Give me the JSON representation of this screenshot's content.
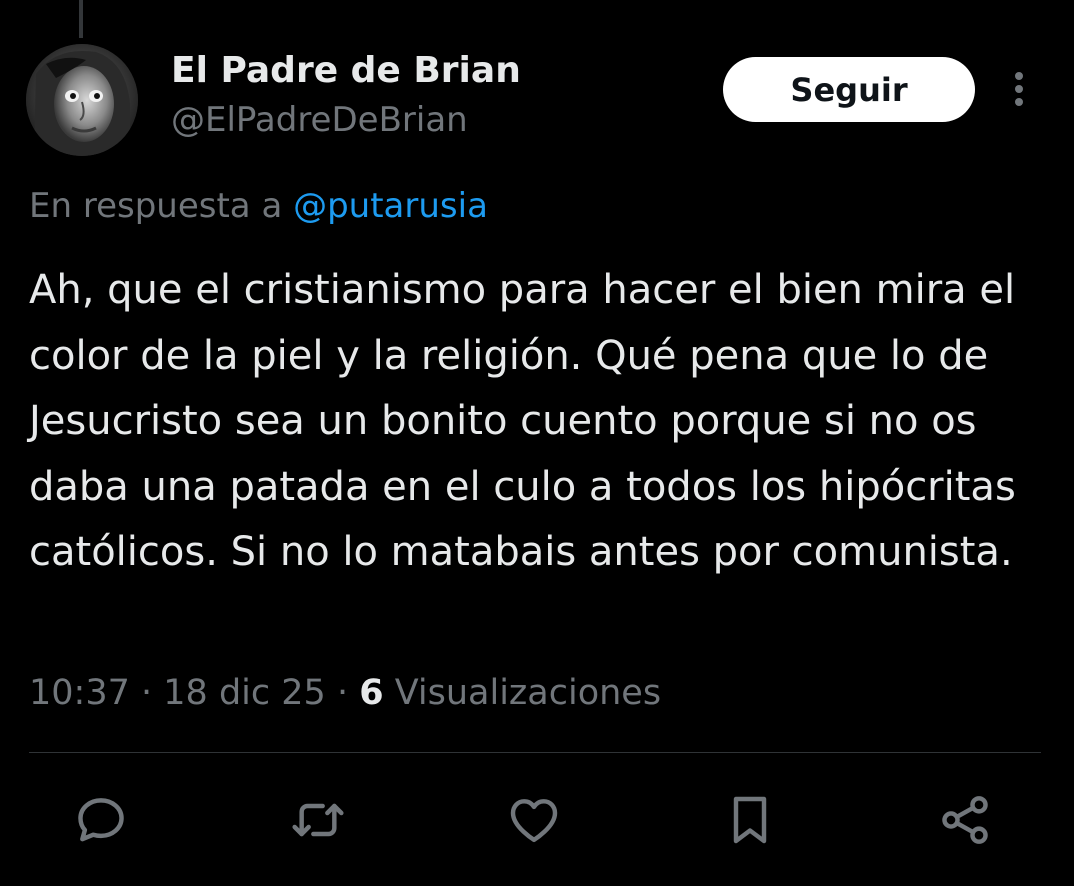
{
  "tweet": {
    "author": {
      "display_name": "El Padre de Brian",
      "handle": "@ElPadreDeBrian"
    },
    "follow_label": "Seguir",
    "reply_prefix": "En respuesta a",
    "reply_mention": "@putarusia",
    "text": "Ah, que el cristianismo para hacer el bien mira el color de la piel y la religión. Qué pena que lo de Jesucristo sea un bonito cuento porque si no os daba una patada en el culo a todos los hipócritas católicos. Si no lo matabais antes por comunista.",
    "time": "10:37",
    "date": "18 dic 25",
    "views_count": "6",
    "views_label": "Visualizaciones"
  },
  "actions": {
    "icons": [
      "reply-icon",
      "retweet-icon",
      "like-icon",
      "bookmark-icon",
      "share-icon"
    ]
  },
  "colors": {
    "background": "#000000",
    "text_primary": "#e7e9ea",
    "text_secondary": "#71767b",
    "accent": "#1d9bf0",
    "follow_bg": "#ffffff"
  }
}
